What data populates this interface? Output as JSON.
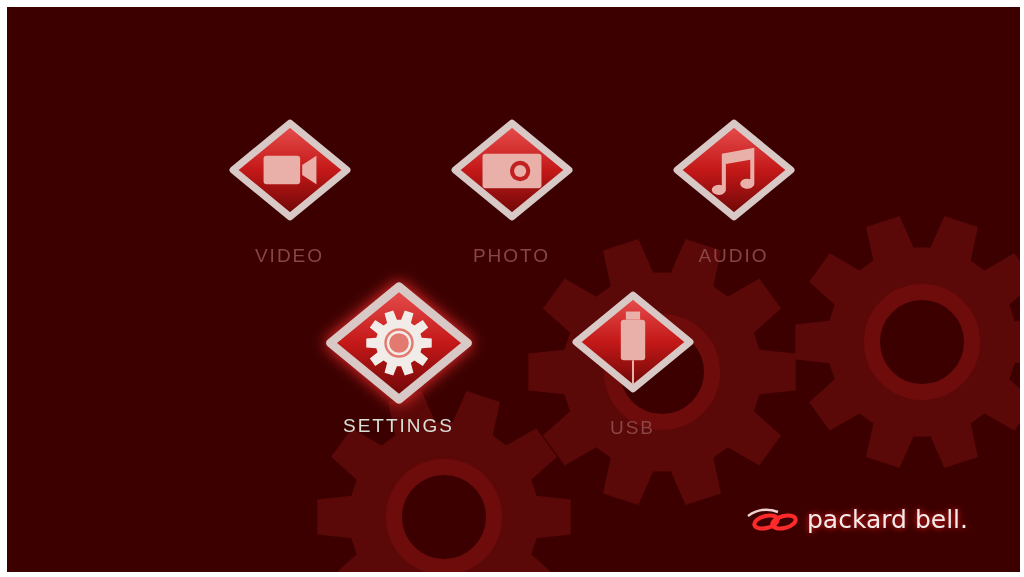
{
  "menu_rows": [
    {
      "items": [
        {
          "kind": "video",
          "label": "VIDEO",
          "selected": false
        },
        {
          "kind": "photo",
          "label": "PHOTO",
          "selected": false
        },
        {
          "kind": "audio",
          "label": "AUDIO",
          "selected": false
        }
      ]
    },
    {
      "items": [
        {
          "kind": "settings",
          "label": "SETTINGS",
          "selected": true
        },
        {
          "kind": "usb",
          "label": "USB",
          "selected": false
        }
      ]
    }
  ],
  "logo": {
    "text": "packard bell."
  }
}
